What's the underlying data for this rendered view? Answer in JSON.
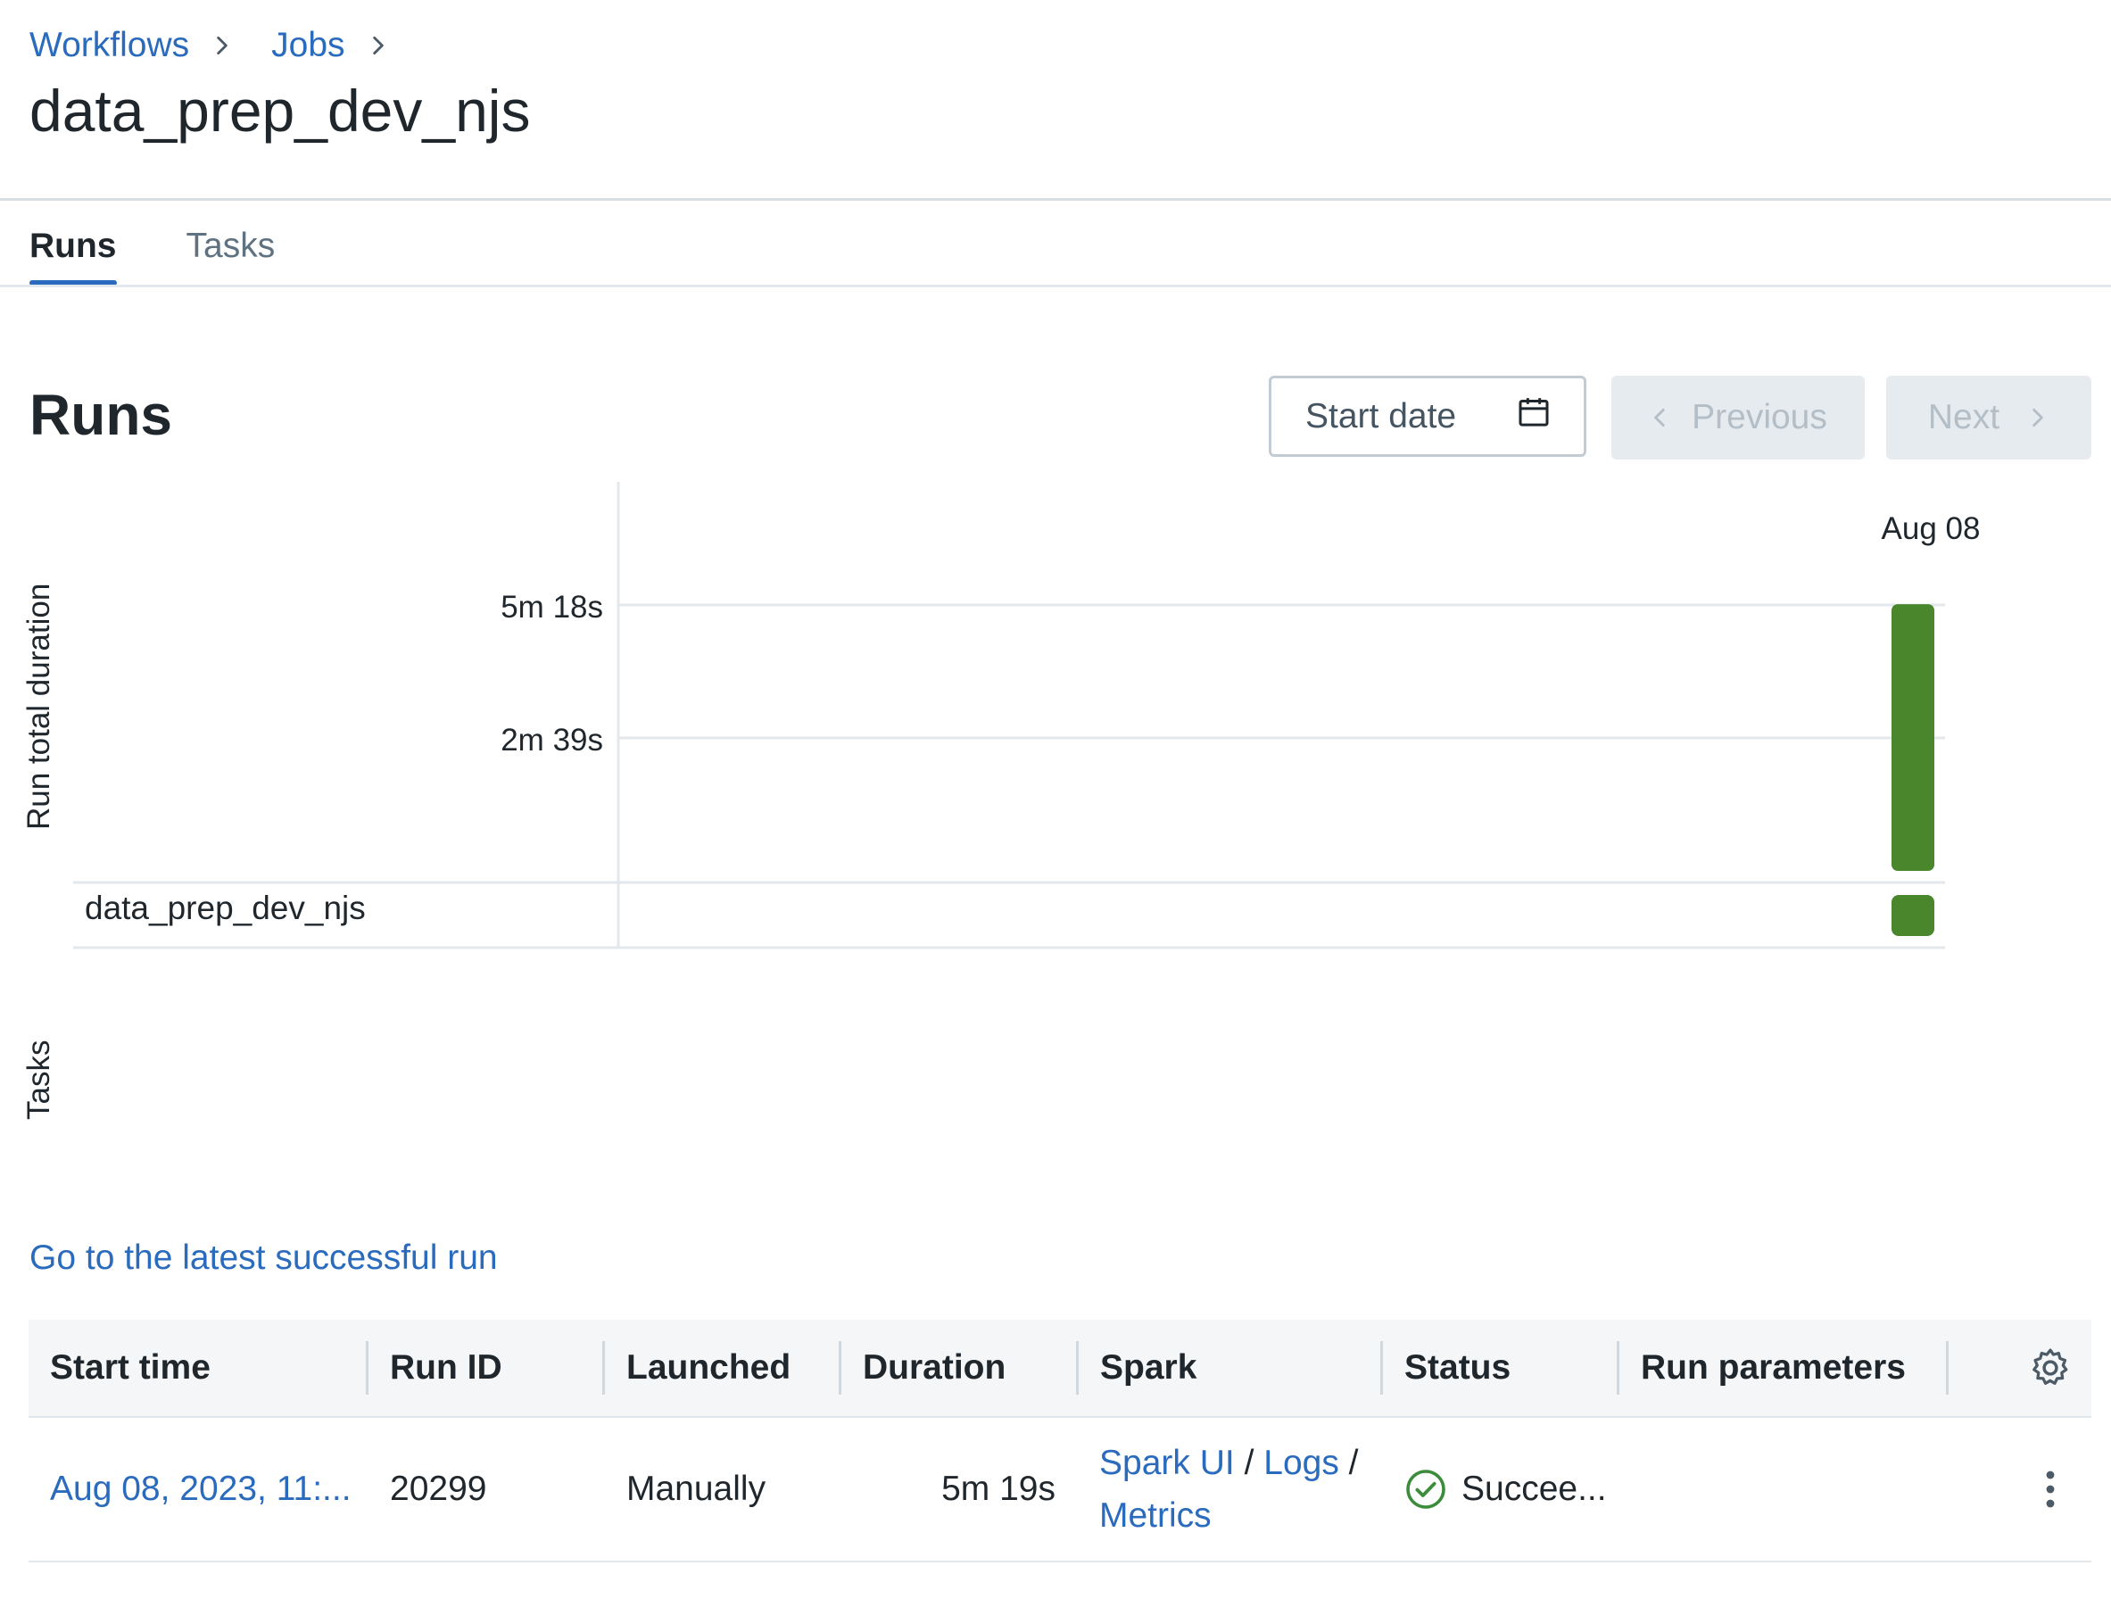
{
  "breadcrumb": {
    "items": [
      {
        "label": "Workflows"
      },
      {
        "label": "Jobs"
      }
    ]
  },
  "page": {
    "title": "data_prep_dev_njs"
  },
  "tabs": [
    {
      "label": "Runs",
      "active": true
    },
    {
      "label": "Tasks",
      "active": false
    }
  ],
  "runs_section": {
    "heading": "Runs",
    "start_date": {
      "placeholder": "Start date",
      "icon": "calendar-icon"
    },
    "previous_label": "Previous",
    "next_label": "Next"
  },
  "chart_data": {
    "type": "bar",
    "ylabel": "Run total duration",
    "tasks_axis_label": "Tasks",
    "y_ticks": [
      "5m 18s",
      "2m 39s"
    ],
    "y_tick_values_seconds": [
      318,
      159
    ],
    "categories": [
      "Aug 08"
    ],
    "values_seconds": [
      319
    ],
    "task_rows": [
      {
        "name": "data_prep_dev_njs",
        "statuses": [
          "success"
        ]
      }
    ],
    "colors": {
      "success": "#4a862c",
      "grid": "#e3e8ec"
    }
  },
  "latest_run_link": "Go to the latest successful run",
  "table": {
    "columns": [
      "Start time",
      "Run ID",
      "Launched",
      "Duration",
      "Spark",
      "Status",
      "Run parameters"
    ],
    "rows": [
      {
        "start_time": "Aug 08, 2023, 11:...",
        "run_id": "20299",
        "launched": "Manually",
        "duration": "5m 19s",
        "spark": {
          "spark_ui": "Spark UI",
          "sep1": "/",
          "logs": "Logs",
          "sep2": "/",
          "metrics": "Metrics"
        },
        "status": "Succee...",
        "status_icon": "check-circle-icon",
        "run_parameters": ""
      }
    ]
  },
  "colors": {
    "link": "#2a6bbd",
    "success": "#4a862c",
    "status_ok": "#3b8c3b"
  }
}
